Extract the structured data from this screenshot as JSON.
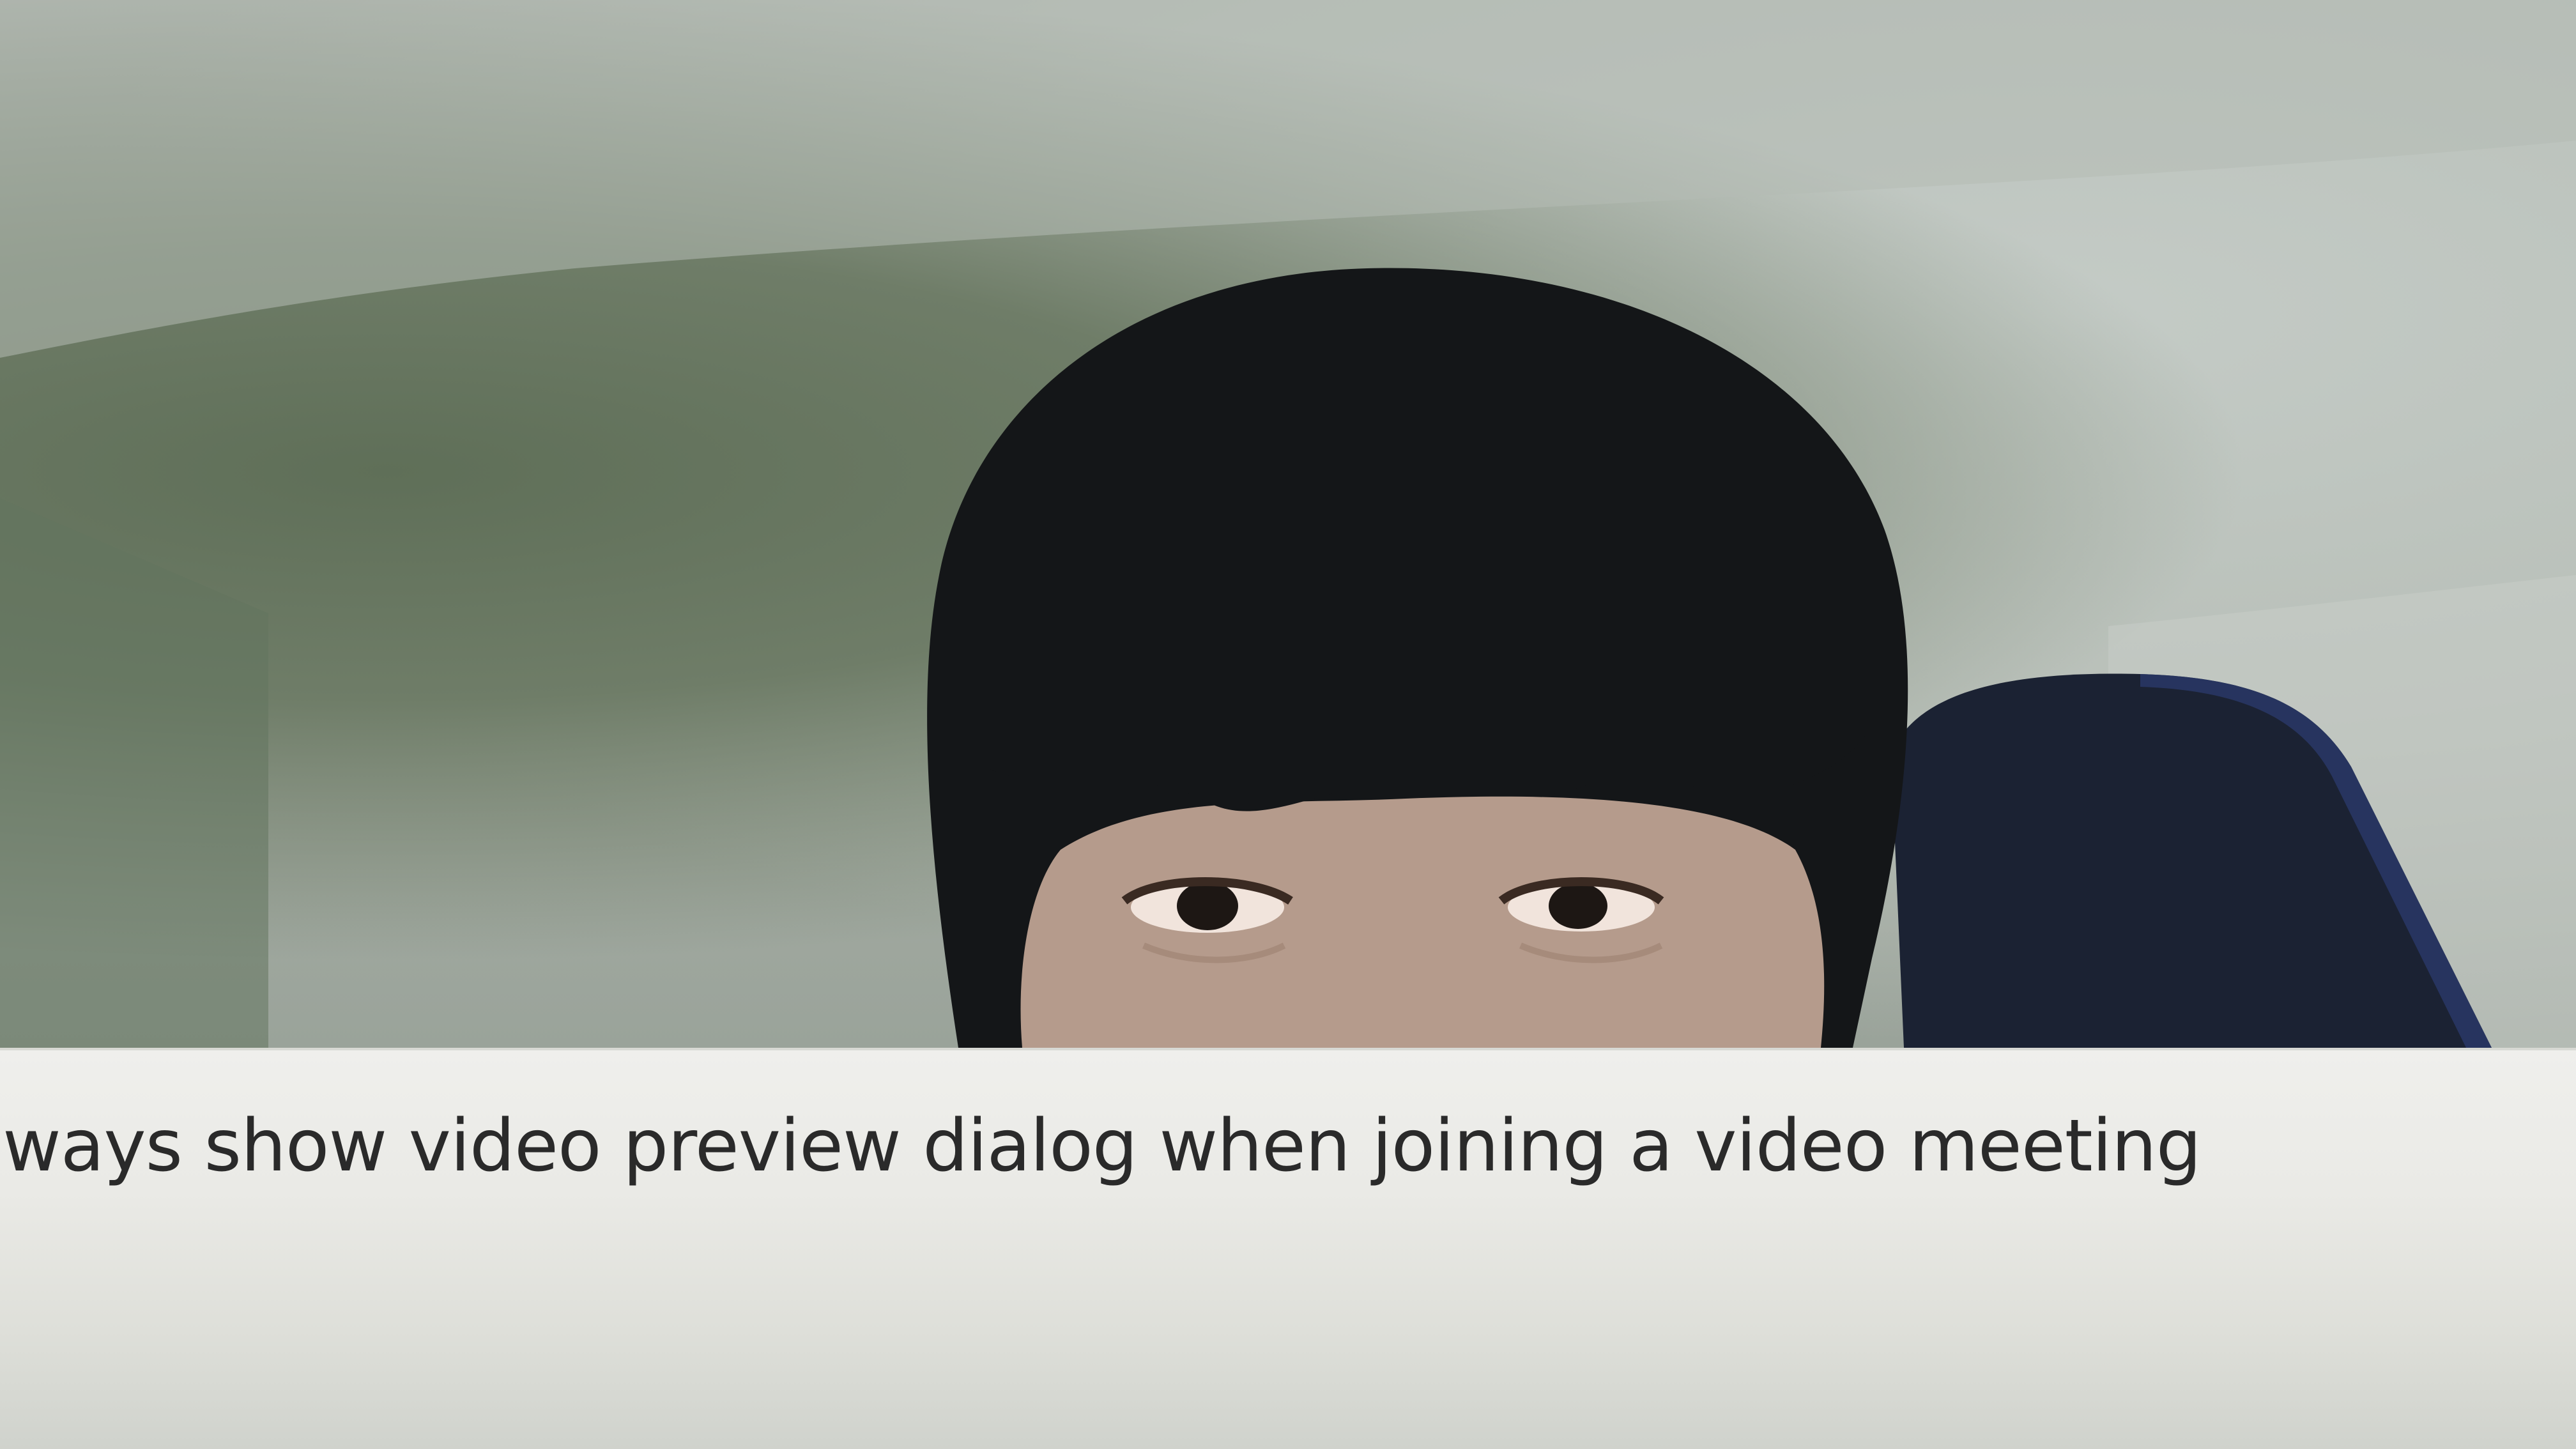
{
  "video_preview": {
    "colors": {
      "wall": "#9aa39a",
      "hair": "#141618",
      "skin": "#b59b8c",
      "chair": "#1b2233"
    }
  },
  "settings": {
    "preview_option": {
      "label": "lways show video preview dialog when joining a video meeting"
    }
  }
}
